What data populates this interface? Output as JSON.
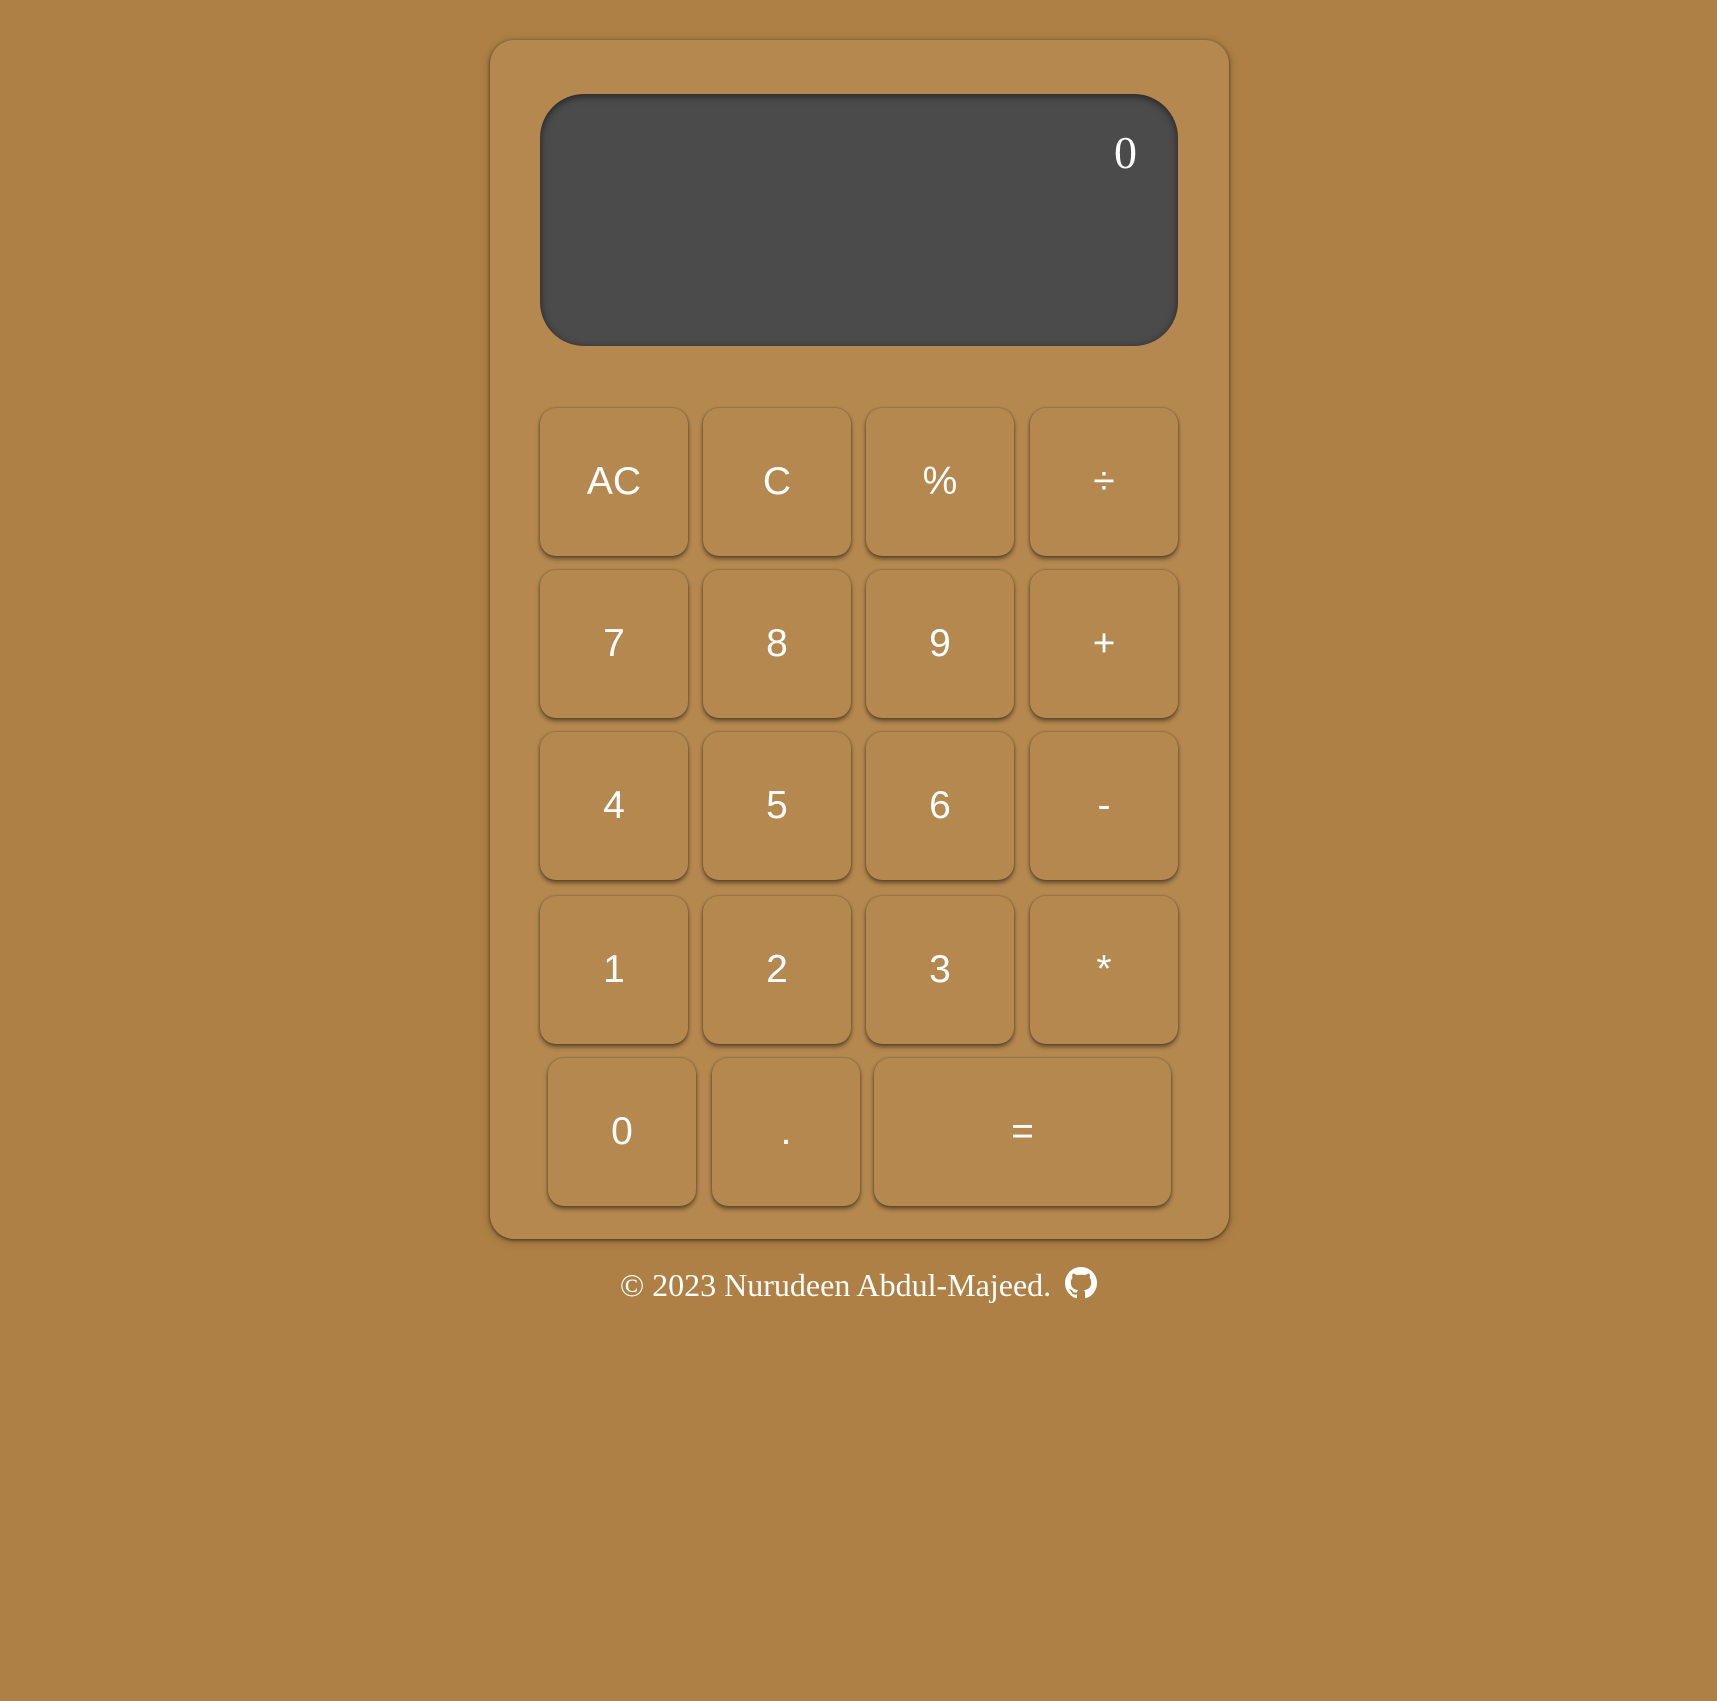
{
  "display": {
    "value": "0"
  },
  "keys": {
    "all_clear": "AC",
    "clear": "C",
    "percent": "%",
    "divide": "÷",
    "seven": "7",
    "eight": "8",
    "nine": "9",
    "plus": "+",
    "four": "4",
    "five": "5",
    "six": "6",
    "minus": "-",
    "one": "1",
    "two": "2",
    "three": "3",
    "multiply": "*",
    "zero": "0",
    "decimal": ".",
    "equals": "="
  },
  "footer": {
    "text": "© 2023 Nurudeen Abdul-Majeed.",
    "icon": "github-icon"
  },
  "colors": {
    "background": "#ae8045",
    "calculator_body": "#b5884f",
    "display": "#4b4b4b",
    "text": "#ffffff"
  }
}
